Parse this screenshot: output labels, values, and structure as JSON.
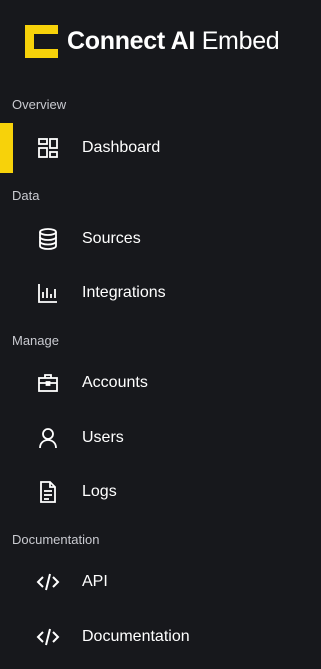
{
  "brand": {
    "name_bold": "Connect AI",
    "name_light": "Embed",
    "accent_color": "#f7d20a"
  },
  "sections": [
    {
      "label": "Overview"
    },
    {
      "label": "Data"
    },
    {
      "label": "Manage"
    },
    {
      "label": "Documentation"
    }
  ],
  "nav": {
    "dashboard": {
      "label": "Dashboard",
      "icon": "dashboard-icon",
      "active": true
    },
    "sources": {
      "label": "Sources",
      "icon": "database-icon"
    },
    "integrations": {
      "label": "Integrations",
      "icon": "bar-chart-icon"
    },
    "accounts": {
      "label": "Accounts",
      "icon": "briefcase-icon"
    },
    "users": {
      "label": "Users",
      "icon": "user-icon"
    },
    "logs": {
      "label": "Logs",
      "icon": "document-icon"
    },
    "api": {
      "label": "API",
      "icon": "code-icon"
    },
    "documentation": {
      "label": "Documentation",
      "icon": "code-icon"
    }
  }
}
